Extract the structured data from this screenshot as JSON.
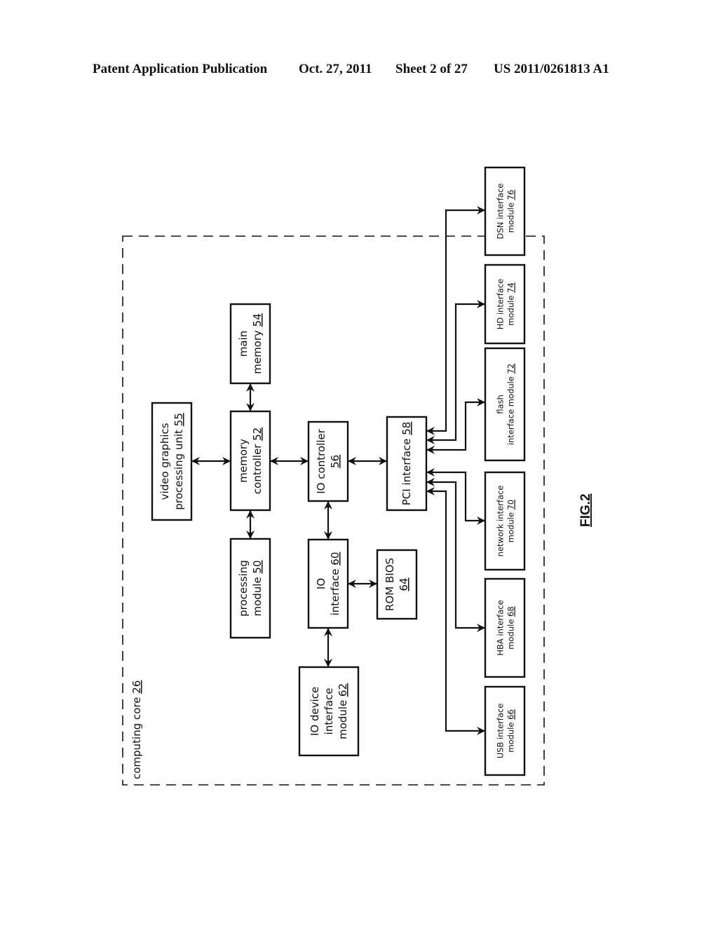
{
  "header": {
    "publication": "Patent Application Publication",
    "date": "Oct. 27, 2011",
    "sheet": "Sheet 2 of 27",
    "number": "US 2011/0261813 A1"
  },
  "figure": {
    "label": "FIG.2",
    "container": {
      "text": "computing core ",
      "ref": "26"
    },
    "blocks": [
      {
        "id": "vgpu",
        "lines": [
          [
            "video graphics",
            ""
          ],
          [
            "processing unit ",
            "55"
          ]
        ]
      },
      {
        "id": "memctl",
        "lines": [
          [
            "memory",
            ""
          ],
          [
            "controller ",
            "52"
          ]
        ]
      },
      {
        "id": "mainmem",
        "lines": [
          [
            "main",
            ""
          ],
          [
            "memory ",
            "54"
          ]
        ]
      },
      {
        "id": "proc",
        "lines": [
          [
            "processing",
            ""
          ],
          [
            "module ",
            "50"
          ]
        ]
      },
      {
        "id": "ioctl",
        "lines": [
          [
            "IO controller",
            ""
          ],
          [
            "",
            "56"
          ]
        ]
      },
      {
        "id": "pci",
        "lines": [
          [
            "PCI interface ",
            "58"
          ]
        ]
      },
      {
        "id": "ioif",
        "lines": [
          [
            "IO",
            ""
          ],
          [
            "interface ",
            "60"
          ]
        ]
      },
      {
        "id": "rombios",
        "lines": [
          [
            "ROM BIOS",
            ""
          ],
          [
            "",
            "64"
          ]
        ]
      },
      {
        "id": "iodev",
        "lines": [
          [
            "IO device",
            ""
          ],
          [
            "interface",
            ""
          ],
          [
            "module ",
            "62"
          ]
        ]
      },
      {
        "id": "usb",
        "lines": [
          [
            "USB interface",
            ""
          ],
          [
            "module ",
            "66"
          ]
        ]
      },
      {
        "id": "hba",
        "lines": [
          [
            "HBA interface",
            ""
          ],
          [
            "module ",
            "68"
          ]
        ]
      },
      {
        "id": "net",
        "lines": [
          [
            "network interface",
            ""
          ],
          [
            "module ",
            "70"
          ]
        ]
      },
      {
        "id": "flash",
        "lines": [
          [
            "flash",
            ""
          ],
          [
            "interface module ",
            "72"
          ]
        ]
      },
      {
        "id": "hd",
        "lines": [
          [
            "HD interface",
            ""
          ],
          [
            "module ",
            "74"
          ]
        ]
      },
      {
        "id": "dsn",
        "lines": [
          [
            "DSN interface",
            ""
          ],
          [
            "module ",
            "76"
          ]
        ]
      }
    ],
    "connections": [
      {
        "from": "vgpu",
        "to": "memctl",
        "type": "bidirectional"
      },
      {
        "from": "memctl",
        "to": "mainmem",
        "type": "bidirectional"
      },
      {
        "from": "memctl",
        "to": "proc",
        "type": "bidirectional"
      },
      {
        "from": "memctl",
        "to": "ioctl",
        "type": "bidirectional"
      },
      {
        "from": "ioctl",
        "to": "pci",
        "type": "bidirectional"
      },
      {
        "from": "ioctl",
        "to": "ioif",
        "type": "bidirectional"
      },
      {
        "from": "ioif",
        "to": "rombios",
        "type": "bidirectional"
      },
      {
        "from": "ioif",
        "to": "iodev",
        "type": "bidirectional"
      },
      {
        "from": "pci",
        "to": "usb",
        "type": "bidirectional"
      },
      {
        "from": "pci",
        "to": "hba",
        "type": "bidirectional"
      },
      {
        "from": "pci",
        "to": "net",
        "type": "bidirectional"
      },
      {
        "from": "pci",
        "to": "flash",
        "type": "bidirectional"
      },
      {
        "from": "pci",
        "to": "hd",
        "type": "bidirectional"
      },
      {
        "from": "pci",
        "to": "dsn",
        "type": "bidirectional"
      }
    ]
  }
}
